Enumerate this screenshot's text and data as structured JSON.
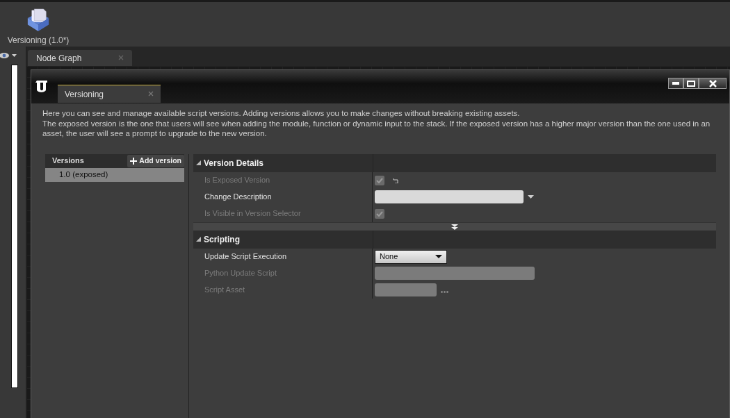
{
  "toolbar": {
    "asset_label": "Versioning (1.0*)"
  },
  "tabs": [
    {
      "label": "Node Graph",
      "selected": true
    }
  ],
  "dialog": {
    "tab": "Versioning",
    "description": [
      "Here you can see and manage available script versions. Adding versions allows you to make changes without breaking existing assets.",
      "The exposed version is the one that users will see when adding the module, function or dynamic input to the stack. If the exposed version has a higher major version than the one used in an asset, the user will see a prompt to upgrade to the new version."
    ]
  },
  "versions": {
    "title": "Versions",
    "add_button": "Add version",
    "items": [
      {
        "label": "1.0 (exposed)",
        "selected": true
      }
    ]
  },
  "categories": [
    {
      "title": "Version Details",
      "expanded": true,
      "advanced": true,
      "rows": [
        {
          "label": "Is Exposed Version",
          "kind": "checkbox",
          "checked": true,
          "disabled": true,
          "reset": true
        },
        {
          "label": "Change Description",
          "kind": "textcombo",
          "disabled": false
        },
        {
          "label": "Is Visible in Version Selector",
          "kind": "checkbox",
          "checked": true,
          "disabled": true
        }
      ]
    },
    {
      "title": "Scripting",
      "expanded": true,
      "advanced": false,
      "rows": [
        {
          "label": "Update Script Execution",
          "kind": "combo",
          "value": "None",
          "disabled": false
        },
        {
          "label": "Python Update Script",
          "kind": "text",
          "disabled": true
        },
        {
          "label": "Script Asset",
          "kind": "asset",
          "disabled": true
        }
      ]
    }
  ]
}
